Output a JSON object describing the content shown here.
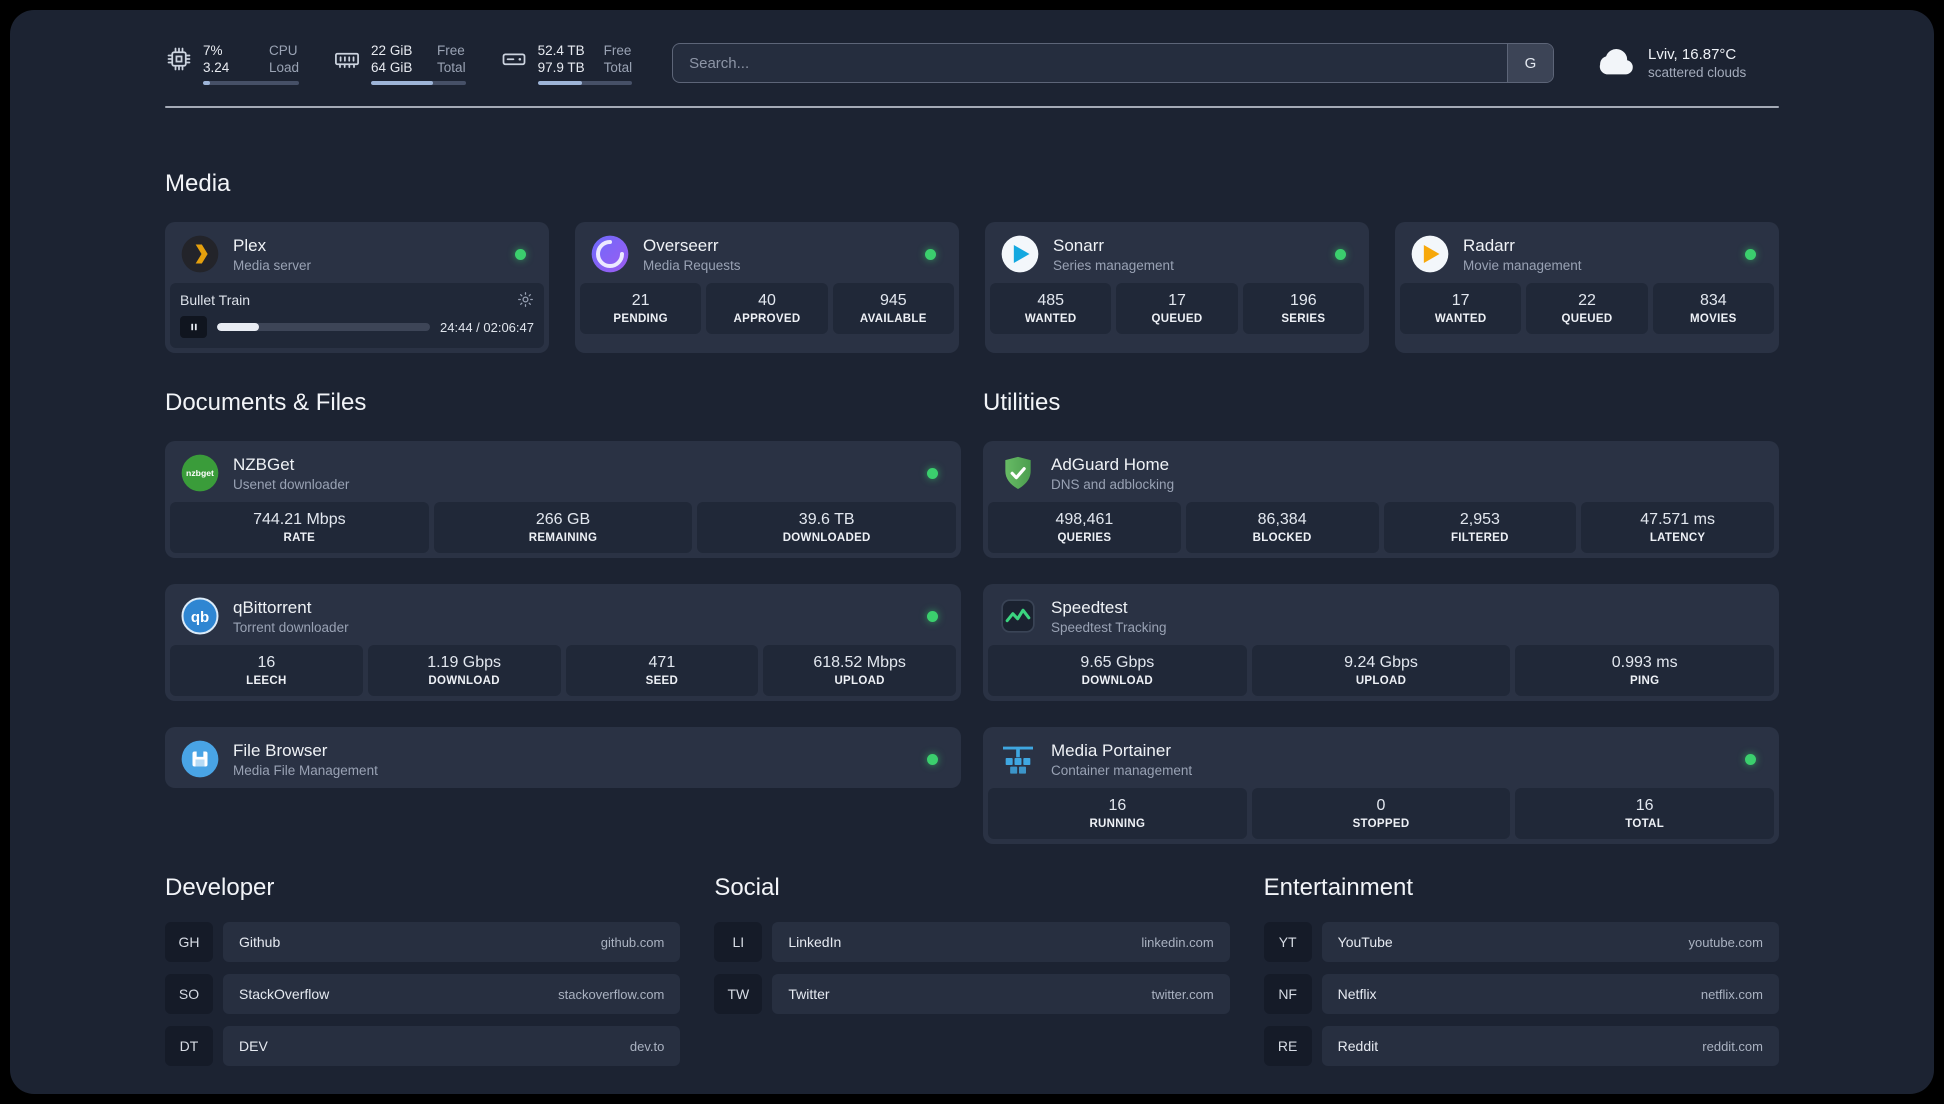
{
  "topbar": {
    "cpu": {
      "value_top": "7%",
      "value_bottom": "3.24",
      "label_top": "CPU",
      "label_bottom": "Load",
      "bar_pct": 7
    },
    "memory": {
      "value_top": "22 GiB",
      "value_bottom": "64 GiB",
      "label_top": "Free",
      "label_bottom": "Total",
      "bar_pct": 66
    },
    "disk": {
      "value_top": "52.4 TB",
      "value_bottom": "97.9 TB",
      "label_top": "Free",
      "label_bottom": "Total",
      "bar_pct": 47
    },
    "search": {
      "placeholder": "Search...",
      "button_label": "G"
    },
    "weather": {
      "location": "Lviv, 16.87°C",
      "condition": "scattered clouds"
    }
  },
  "media": {
    "title": "Media",
    "plex": {
      "name": "Plex",
      "desc": "Media server",
      "now_playing": {
        "title": "Bullet Train",
        "time": "24:44 / 02:06:47",
        "progress_pct": 19.5
      }
    },
    "overseerr": {
      "name": "Overseerr",
      "desc": "Media Requests",
      "stats": [
        {
          "value": "21",
          "label": "PENDING"
        },
        {
          "value": "40",
          "label": "APPROVED"
        },
        {
          "value": "945",
          "label": "AVAILABLE"
        }
      ]
    },
    "sonarr": {
      "name": "Sonarr",
      "desc": "Series management",
      "stats": [
        {
          "value": "485",
          "label": "WANTED"
        },
        {
          "value": "17",
          "label": "QUEUED"
        },
        {
          "value": "196",
          "label": "SERIES"
        }
      ]
    },
    "radarr": {
      "name": "Radarr",
      "desc": "Movie management",
      "stats": [
        {
          "value": "17",
          "label": "WANTED"
        },
        {
          "value": "22",
          "label": "QUEUED"
        },
        {
          "value": "834",
          "label": "MOVIES"
        }
      ]
    }
  },
  "documents": {
    "title": "Documents & Files",
    "nzbget": {
      "name": "NZBGet",
      "desc": "Usenet downloader",
      "stats": [
        {
          "value": "744.21 Mbps",
          "label": "RATE"
        },
        {
          "value": "266 GB",
          "label": "REMAINING"
        },
        {
          "value": "39.6 TB",
          "label": "DOWNLOADED"
        }
      ]
    },
    "qbittorrent": {
      "name": "qBittorrent",
      "desc": "Torrent downloader",
      "stats": [
        {
          "value": "16",
          "label": "LEECH"
        },
        {
          "value": "1.19 Gbps",
          "label": "DOWNLOAD"
        },
        {
          "value": "471",
          "label": "SEED"
        },
        {
          "value": "618.52 Mbps",
          "label": "UPLOAD"
        }
      ]
    },
    "filebrowser": {
      "name": "File Browser",
      "desc": "Media File Management"
    }
  },
  "utilities": {
    "title": "Utilities",
    "adguard": {
      "name": "AdGuard Home",
      "desc": "DNS and adblocking",
      "stats": [
        {
          "value": "498,461",
          "label": "QUERIES"
        },
        {
          "value": "86,384",
          "label": "BLOCKED"
        },
        {
          "value": "2,953",
          "label": "FILTERED"
        },
        {
          "value": "47.571 ms",
          "label": "LATENCY"
        }
      ]
    },
    "speedtest": {
      "name": "Speedtest",
      "desc": "Speedtest Tracking",
      "stats": [
        {
          "value": "9.65 Gbps",
          "label": "DOWNLOAD"
        },
        {
          "value": "9.24 Gbps",
          "label": "UPLOAD"
        },
        {
          "value": "0.993 ms",
          "label": "PING"
        }
      ]
    },
    "portainer": {
      "name": "Media Portainer",
      "desc": "Container management",
      "stats": [
        {
          "value": "16",
          "label": "RUNNING"
        },
        {
          "value": "0",
          "label": "STOPPED"
        },
        {
          "value": "16",
          "label": "TOTAL"
        }
      ]
    }
  },
  "bookmarks": {
    "developer": {
      "title": "Developer",
      "items": [
        {
          "abbr": "GH",
          "name": "Github",
          "url": "github.com"
        },
        {
          "abbr": "SO",
          "name": "StackOverflow",
          "url": "stackoverflow.com"
        },
        {
          "abbr": "DT",
          "name": "DEV",
          "url": "dev.to"
        }
      ]
    },
    "social": {
      "title": "Social",
      "items": [
        {
          "abbr": "LI",
          "name": "LinkedIn",
          "url": "linkedin.com"
        },
        {
          "abbr": "TW",
          "name": "Twitter",
          "url": "twitter.com"
        }
      ]
    },
    "entertainment": {
      "title": "Entertainment",
      "items": [
        {
          "abbr": "YT",
          "name": "YouTube",
          "url": "youtube.com"
        },
        {
          "abbr": "NF",
          "name": "Netflix",
          "url": "netflix.com"
        },
        {
          "abbr": "RE",
          "name": "Reddit",
          "url": "reddit.com"
        }
      ]
    }
  }
}
